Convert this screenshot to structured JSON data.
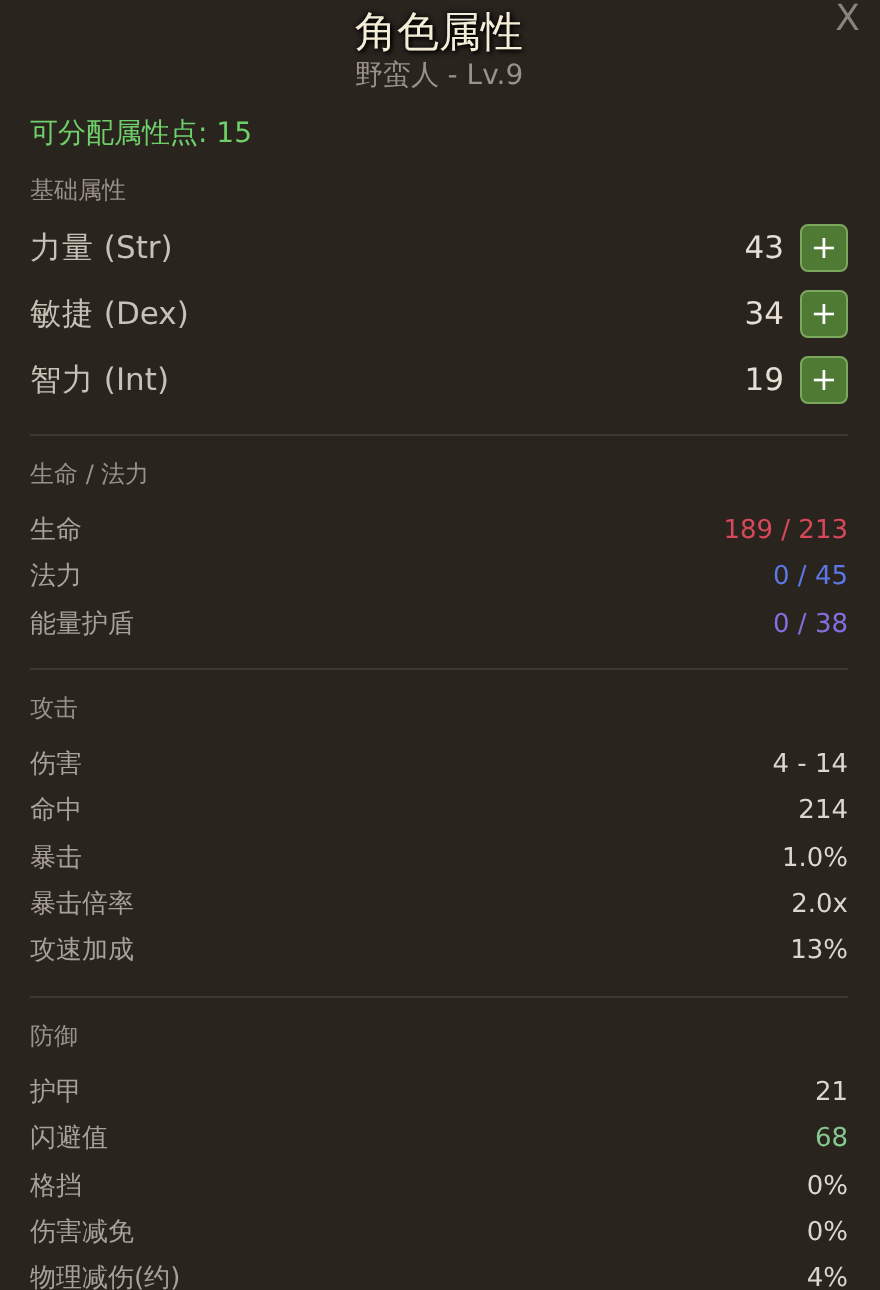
{
  "window": {
    "title": "角色属性",
    "subtitle": "野蛮人 - Lv.9",
    "close": "X"
  },
  "unspent_points": "可分配属性点: 15",
  "attributes": {
    "heading": "基础属性",
    "items": [
      {
        "name": "力量 (Str)",
        "value": "43",
        "button": "+"
      },
      {
        "name": "敏捷 (Dex)",
        "value": "34",
        "button": "+"
      },
      {
        "name": "智力 (Int)",
        "value": "19",
        "button": "+"
      }
    ]
  },
  "sections": [
    {
      "heading": "生命 / 法力",
      "stats": [
        {
          "name": "生命",
          "value": "189 / 213",
          "color": "#d9485a"
        },
        {
          "name": "法力",
          "value": "0 / 45",
          "color": "#5a78e6"
        },
        {
          "name": "能量护盾",
          "value": "0 / 38",
          "color": "#8070e0"
        }
      ]
    },
    {
      "heading": "攻击",
      "stats": [
        {
          "name": "伤害",
          "value": "4 - 14",
          "color": "#dcd6cc"
        },
        {
          "name": "命中",
          "value": "214",
          "color": "#dcd6cc"
        },
        {
          "name": "暴击",
          "value": "1.0%",
          "color": "#dcd6cc"
        },
        {
          "name": "暴击倍率",
          "value": "2.0x",
          "color": "#dcd6cc"
        },
        {
          "name": "攻速加成",
          "value": "13%",
          "color": "#dcd6cc"
        }
      ]
    },
    {
      "heading": "防御",
      "stats": [
        {
          "name": "护甲",
          "value": "21",
          "color": "#dcd6cc"
        },
        {
          "name": "闪避值",
          "value": "68",
          "color": "#86c88e"
        },
        {
          "name": "格挡",
          "value": "0%",
          "color": "#dcd6cc"
        },
        {
          "name": "伤害减免",
          "value": "0%",
          "color": "#dcd6cc"
        },
        {
          "name": "物理减伤(约)",
          "value": "4%",
          "color": "#dcd6cc"
        }
      ]
    }
  ]
}
